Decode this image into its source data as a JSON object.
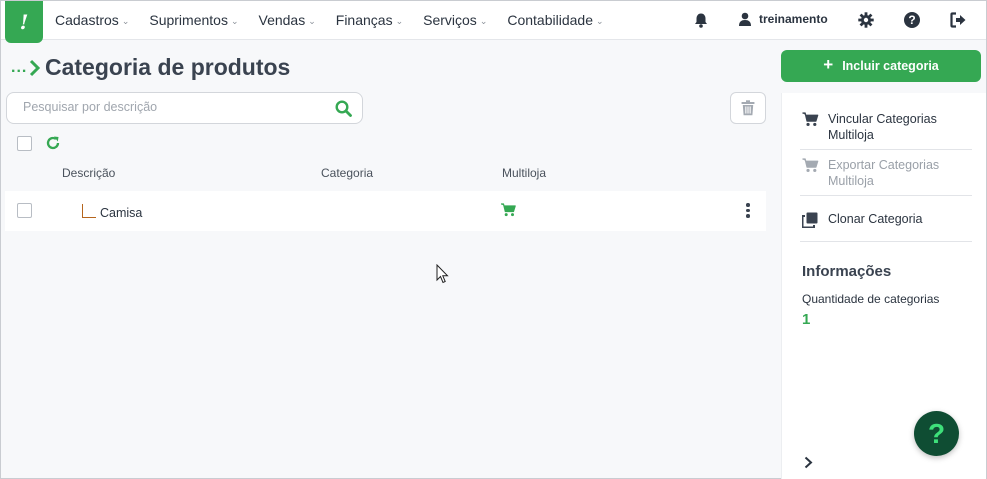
{
  "app": {
    "logo_text": "!"
  },
  "menu": [
    {
      "label": "Cadastros"
    },
    {
      "label": "Suprimentos"
    },
    {
      "label": "Vendas"
    },
    {
      "label": "Finanças"
    },
    {
      "label": "Serviços"
    },
    {
      "label": "Contabilidade"
    }
  ],
  "user": {
    "name": "treinamento"
  },
  "breadcrumb": {
    "dots": "..."
  },
  "page": {
    "title": "Categoria de produtos"
  },
  "search": {
    "placeholder": "Pesquisar por descrição",
    "value": ""
  },
  "table": {
    "columns": [
      "Descrição",
      "Categoria",
      "Multiloja"
    ],
    "rows": [
      {
        "descricao": "Camisa",
        "categoria": "",
        "multiloja": "cart-icon"
      }
    ]
  },
  "sidebar": {
    "add_button": "Incluir categoria",
    "actions": [
      {
        "label": "Vincular Categorias Multiloja",
        "icon": "cart-icon",
        "enabled": true
      },
      {
        "label": "Exportar Categorias Multiloja",
        "icon": "cart-icon",
        "enabled": false
      },
      {
        "label": "Clonar Categoria",
        "icon": "clone-icon",
        "enabled": true
      }
    ],
    "info": {
      "title": "Informações",
      "count_label": "Quantidade de categorias",
      "count_value": "1"
    }
  },
  "help": {
    "label": "?"
  },
  "colors": {
    "brand": "#35a853",
    "fab_bg": "#0f4d33",
    "text": "#2b3440"
  }
}
